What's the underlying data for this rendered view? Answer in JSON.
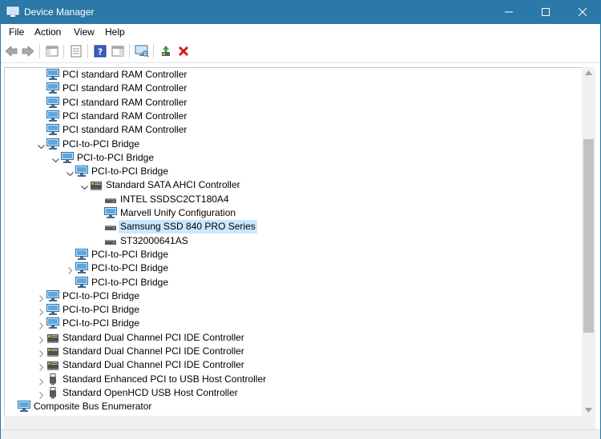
{
  "window": {
    "title": "Device Manager",
    "accent": "#2b79a8"
  },
  "menu": [
    {
      "label": "File",
      "name": "menu-file"
    },
    {
      "label": "Action",
      "name": "menu-action"
    },
    {
      "label": "View",
      "name": "menu-view"
    },
    {
      "label": "Help",
      "name": "menu-help"
    }
  ],
  "toolbar": {
    "buttons": [
      {
        "name": "back-icon"
      },
      {
        "name": "forward-icon"
      },
      {
        "name": "show-hide-console-tree-icon"
      },
      {
        "name": "properties-icon"
      },
      {
        "name": "help-icon"
      },
      {
        "name": "action-pane-icon"
      },
      {
        "name": "scan-hardware-changes-icon"
      },
      {
        "name": "update-driver-icon"
      },
      {
        "name": "uninstall-device-icon"
      }
    ]
  },
  "tree": [
    {
      "label": "PCI standard RAM Controller",
      "level": 3,
      "expander": "none",
      "icon": "pci-device"
    },
    {
      "label": "PCI standard RAM Controller",
      "level": 3,
      "expander": "none",
      "icon": "pci-device"
    },
    {
      "label": "PCI standard RAM Controller",
      "level": 3,
      "expander": "none",
      "icon": "pci-device"
    },
    {
      "label": "PCI standard RAM Controller",
      "level": 3,
      "expander": "none",
      "icon": "pci-device"
    },
    {
      "label": "PCI standard RAM Controller",
      "level": 3,
      "expander": "none",
      "icon": "pci-device"
    },
    {
      "label": "PCI-to-PCI Bridge",
      "level": 3,
      "expander": "expanded",
      "icon": "pci-device"
    },
    {
      "label": "PCI-to-PCI Bridge",
      "level": 4,
      "expander": "expanded",
      "icon": "pci-device"
    },
    {
      "label": "PCI-to-PCI Bridge",
      "level": 5,
      "expander": "expanded",
      "icon": "pci-device"
    },
    {
      "label": "Standard SATA AHCI Controller",
      "level": 6,
      "expander": "expanded",
      "icon": "storage-controller"
    },
    {
      "label": "INTEL SSDSC2CT180A4",
      "level": 7,
      "expander": "none",
      "icon": "disk-drive"
    },
    {
      "label": "Marvell Unify Configuration",
      "level": 7,
      "expander": "none",
      "icon": "pci-device"
    },
    {
      "label": "Samsung SSD 840 PRO Series",
      "level": 7,
      "expander": "none",
      "icon": "disk-drive",
      "selected": true
    },
    {
      "label": "ST32000641AS",
      "level": 7,
      "expander": "none",
      "icon": "disk-drive"
    },
    {
      "label": "PCI-to-PCI Bridge",
      "level": 5,
      "expander": "none",
      "icon": "pci-device"
    },
    {
      "label": "PCI-to-PCI Bridge",
      "level": 5,
      "expander": "collapsed",
      "icon": "pci-device"
    },
    {
      "label": "PCI-to-PCI Bridge",
      "level": 5,
      "expander": "none",
      "icon": "pci-device"
    },
    {
      "label": "PCI-to-PCI Bridge",
      "level": 3,
      "expander": "collapsed",
      "icon": "pci-device"
    },
    {
      "label": "PCI-to-PCI Bridge",
      "level": 3,
      "expander": "collapsed",
      "icon": "pci-device"
    },
    {
      "label": "PCI-to-PCI Bridge",
      "level": 3,
      "expander": "collapsed",
      "icon": "pci-device"
    },
    {
      "label": "Standard Dual Channel PCI IDE Controller",
      "level": 3,
      "expander": "collapsed",
      "icon": "storage-controller"
    },
    {
      "label": "Standard Dual Channel PCI IDE Controller",
      "level": 3,
      "expander": "collapsed",
      "icon": "storage-controller"
    },
    {
      "label": "Standard Dual Channel PCI IDE Controller",
      "level": 3,
      "expander": "collapsed",
      "icon": "storage-controller"
    },
    {
      "label": "Standard Enhanced PCI to USB Host Controller",
      "level": 3,
      "expander": "collapsed",
      "icon": "usb-controller"
    },
    {
      "label": "Standard OpenHCD USB Host Controller",
      "level": 3,
      "expander": "collapsed",
      "icon": "usb-controller"
    },
    {
      "label": "Composite Bus Enumerator",
      "level": 1,
      "expander": "none",
      "icon": "pci-device"
    }
  ]
}
